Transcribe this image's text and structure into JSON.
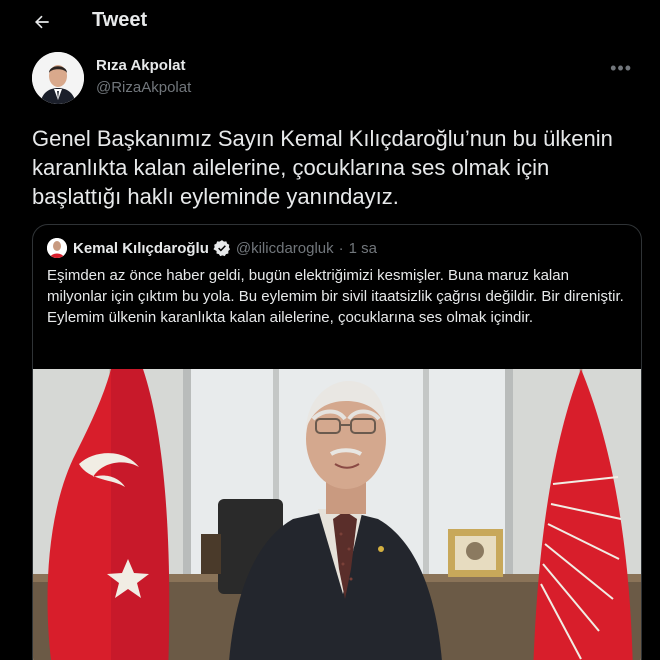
{
  "header": {
    "title": "Tweet"
  },
  "author": {
    "name": "Rıza Akpolat",
    "handle": "@RizaAkpolat"
  },
  "tweet": {
    "text": "Genel Başkanımız Sayın Kemal Kılıçdaroğlu’nun bu ülkenin karanlıkta kalan ailelerine, çocuklarına ses olmak için başlattığı haklı eyleminde yanındayız."
  },
  "quote": {
    "name": "Kemal Kılıçdaroğlu",
    "handle": "@kilicdarogluk",
    "separator": "·",
    "time": "1 sa",
    "text": "Eşimden az önce haber geldi, bugün elektriğimizi kesmişler. Buna maruz kalan milyonlar için çıktım bu yola. Bu eylemim bir sivil itaatsizlik çağrısı değildir. Bir direniştir. Eylemim ülkenin karanlıkta kalan ailelerine, çocuklarına ses olmak içindir."
  },
  "icons": {
    "back": "arrow-left-icon",
    "more": "more-icon",
    "verified": "verified-badge-icon"
  },
  "colors": {
    "background": "#000000",
    "text": "#e7e9ea",
    "muted": "#71767b",
    "border": "#2f3336",
    "verified": "#1d9bf0",
    "flag": "#d81e2b"
  }
}
